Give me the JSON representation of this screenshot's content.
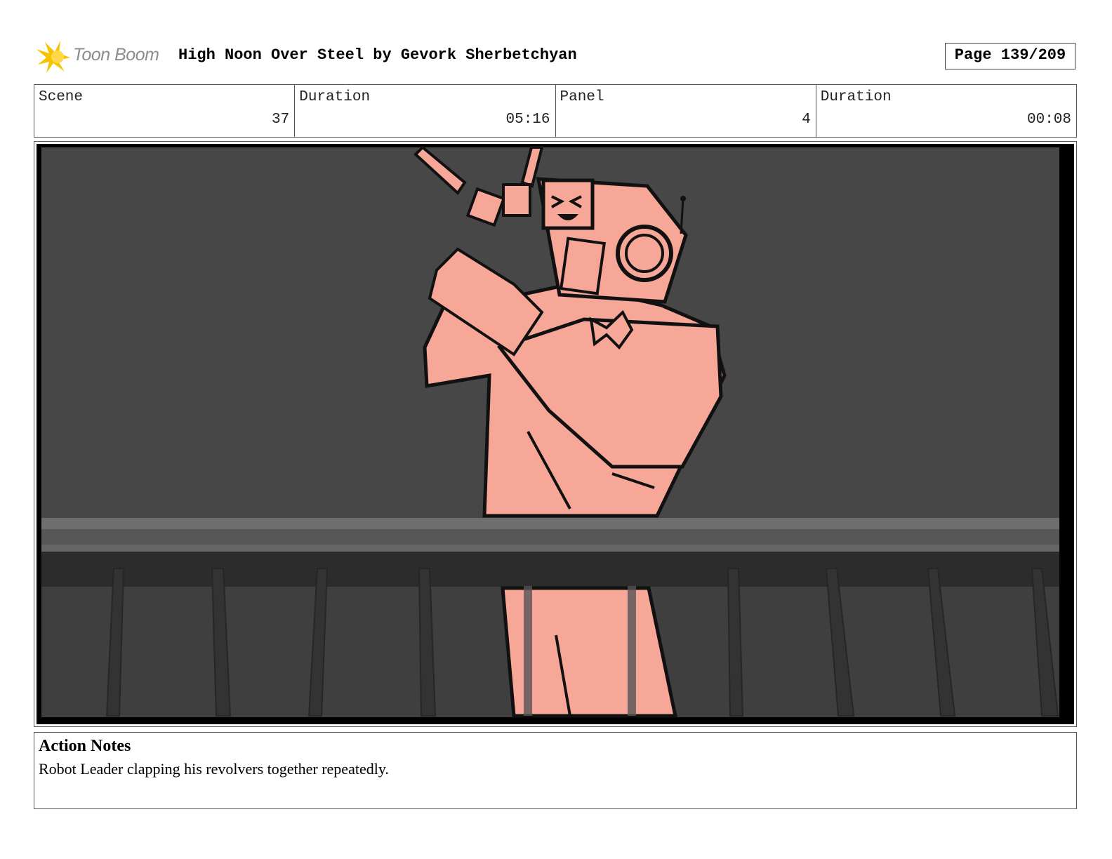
{
  "header": {
    "logo_text": "Toon Boom",
    "title": "High Noon Over Steel by Gevork Sherbetchyan",
    "page": "Page 139/209"
  },
  "info": {
    "scene_label": "Scene",
    "scene_value": "37",
    "scene_duration_label": "Duration",
    "scene_duration_value": "05:16",
    "panel_label": "Panel",
    "panel_value": "4",
    "panel_duration_label": "Duration",
    "panel_duration_value": "00:08"
  },
  "notes": {
    "title": "Action Notes",
    "body": "Robot Leader clapping his revolvers together repeatedly."
  },
  "colors": {
    "character_fill": "#f7a797",
    "background": "#474747",
    "logo_yellow": "#f5c400"
  }
}
